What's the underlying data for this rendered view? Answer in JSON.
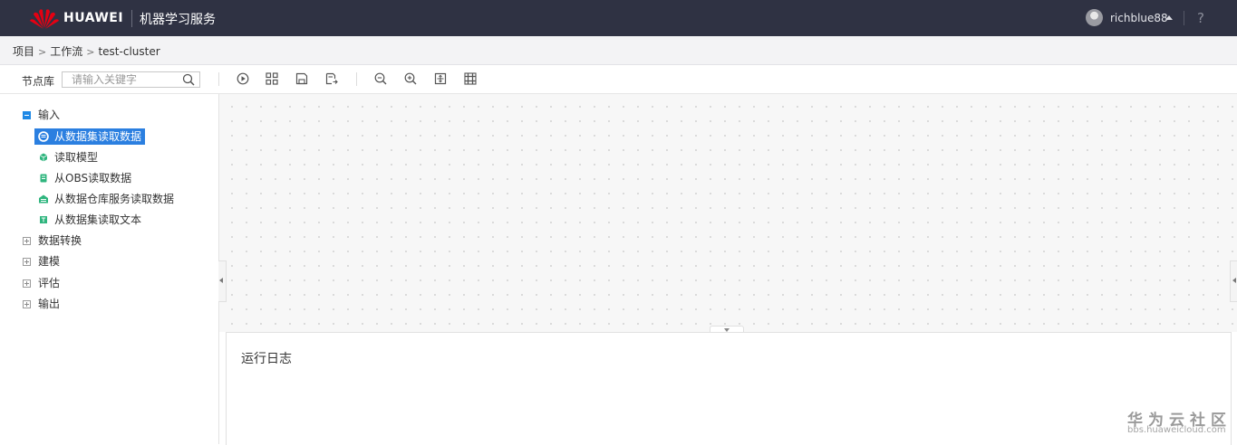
{
  "header": {
    "brand": "HUAWEI",
    "service": "机器学习服务",
    "username": "richblue88",
    "help_label": "?"
  },
  "breadcrumb": {
    "items": [
      "项目",
      "工作流",
      "test-cluster"
    ]
  },
  "toolbar": {
    "library_label": "节点库",
    "search_placeholder": "请输入关键字",
    "buttons": [
      "run-icon",
      "layout-icon",
      "save-icon",
      "save-as-icon",
      "zoom-out-icon",
      "zoom-in-icon",
      "fit-icon",
      "grid-icon"
    ]
  },
  "tree": {
    "input": {
      "label": "输入",
      "children": [
        "从数据集读取数据",
        "读取模型",
        "从OBS读取数据",
        "从数据仓库服务读取数据",
        "从数据集读取文本"
      ]
    },
    "transform": {
      "label": "数据转换"
    },
    "modeling": {
      "label": "建模"
    },
    "evaluate": {
      "label": "评估"
    },
    "output": {
      "label": "输出"
    }
  },
  "log": {
    "title": "运行日志"
  },
  "watermark": {
    "main": "华为云社区",
    "sub": "bbs.huaweicloud.com"
  },
  "colors": {
    "header_bg": "#2f3243",
    "accent": "#2b7fe0",
    "logo": "#e60012"
  }
}
